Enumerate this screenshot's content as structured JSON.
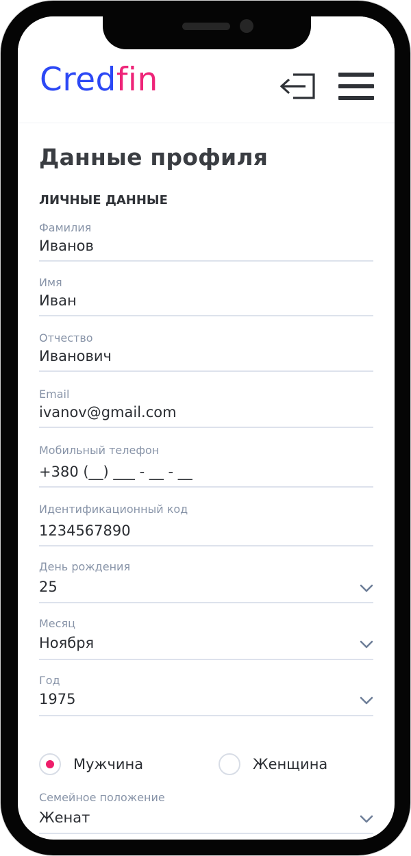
{
  "brand": {
    "part1": "Cred",
    "part2": "fin",
    "color1": "#2c48f5",
    "color2": "#ee2478"
  },
  "header": {
    "logout_icon": "logout-icon",
    "menu_icon": "hamburger-menu-icon"
  },
  "page": {
    "title": "Данные профиля",
    "section": "ЛИЧНЫЕ ДАННЫЕ"
  },
  "fields": {
    "last_name": {
      "label": "Фамилия",
      "value": "Иванов"
    },
    "first_name": {
      "label": "Имя",
      "value": "Иван"
    },
    "patronymic": {
      "label": "Отчество",
      "value": "Иванович"
    },
    "email": {
      "label": "Email",
      "value": "ivanov@gmail.com"
    },
    "phone": {
      "label": "Мобильный телефон",
      "value": "+380 (__) ___ -  __ - __"
    },
    "tax_id": {
      "label": "Идентификационный код",
      "value": "1234567890"
    },
    "birth_day": {
      "label": "День рождения",
      "value": "25"
    },
    "birth_month": {
      "label": "Месяц",
      "value": "Ноября"
    },
    "birth_year": {
      "label": "Год",
      "value": "1975"
    },
    "marital": {
      "label": "Семейное положение",
      "value": "Женат"
    }
  },
  "gender": {
    "male": {
      "label": "Мужчина",
      "selected": true
    },
    "female": {
      "label": "Женщина",
      "selected": false
    },
    "accent": "#ee1e6a"
  }
}
